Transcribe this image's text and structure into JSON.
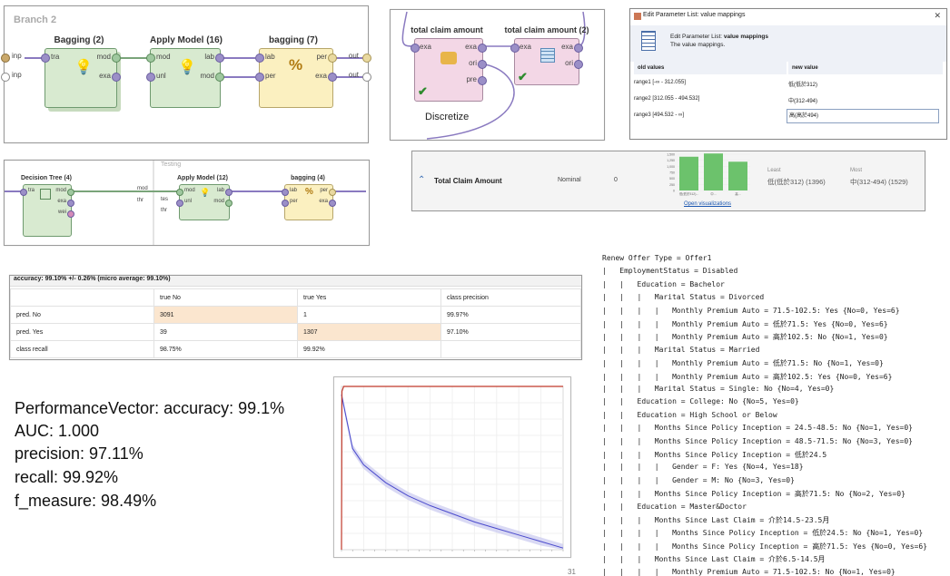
{
  "branch_panel": {
    "branch_title": "Branch 2",
    "bagging": {
      "title": "Bagging (2)",
      "in_port": "tra",
      "out_ports": [
        "mod",
        "exa"
      ]
    },
    "apply_model": {
      "title": "Apply Model (16)",
      "in_ports": [
        "mod",
        "unl"
      ],
      "out_ports": [
        "lab",
        "mod"
      ]
    },
    "perf": {
      "title": "bagging (7)",
      "in_ports": [
        "lab",
        "per"
      ],
      "out_ports": [
        "per",
        "exa"
      ]
    },
    "left_ports": [
      "inp",
      "inp"
    ],
    "right_ports": [
      "out",
      "out"
    ]
  },
  "discretize_panel": {
    "op1_title": "total claim amount",
    "op1_ports": [
      "exa",
      "exa",
      "ori",
      "pre"
    ],
    "op2_title": "total claim amount (2)",
    "op2_ports": [
      "exa",
      "exa",
      "ori"
    ],
    "caption": "Discretize"
  },
  "param_dialog": {
    "window_title": "Edit Parameter List: value mappings",
    "close_glyph": "✕",
    "header_prefix": "Edit Parameter List: ",
    "header_bold": "value mappings",
    "subheader": "The value mappings.",
    "columns": [
      "old values",
      "new value"
    ],
    "rows": [
      {
        "old": "range1 [-∞ - 312.055]",
        "new": "低(低於312)"
      },
      {
        "old": "range2 [312.055 - 494.532]",
        "new": "中(312-494)"
      },
      {
        "old": "range3 [494.532 - ∞]",
        "new": "高(高於494)"
      }
    ]
  },
  "tree_panel": {
    "tab": "Testing",
    "decision_tree": {
      "title": "Decision Tree (4)",
      "in_port": "tra",
      "out_ports": [
        "mod",
        "exa",
        "wei"
      ]
    },
    "apply_model": {
      "title": "Apply Model (12)",
      "in_ports": [
        "mod",
        "unl"
      ],
      "out_ports": [
        "lab",
        "mod"
      ],
      "left_labels": [
        "mod",
        "tes",
        "thr",
        "thr"
      ]
    },
    "perf": {
      "title": "bagging (4)",
      "in_ports": [
        "lab",
        "per"
      ],
      "out_ports": [
        "per",
        "exa"
      ]
    }
  },
  "stats_row": {
    "name": "Total Claim Amount",
    "type": "Nominal",
    "missing": "0",
    "least_label": "Least",
    "least_value": "低(低於312) (1396)",
    "most_label": "Most",
    "most_value": "中(312-494) (1529)",
    "link": "Open visualizations",
    "axis_ticks": [
      "1,500",
      "1,250",
      "1,000",
      "750",
      "500",
      "250",
      "0"
    ],
    "category_ticks": [
      "低(低於312)...",
      "中...",
      "高..."
    ],
    "chart_data": {
      "type": "bar",
      "categories": [
        "低(低於312)...",
        "中...",
        "高..."
      ],
      "values": [
        1396,
        1529,
        1190
      ],
      "ylim": [
        0,
        1500
      ]
    }
  },
  "confusion": {
    "title": "accuracy: 99.10% +/- 0.26% (micro average: 99.10%)",
    "header": [
      "",
      "true No",
      "true Yes",
      "class precision"
    ],
    "rows": [
      [
        "pred. No",
        "3091",
        "1",
        "99.97%"
      ],
      [
        "pred. Yes",
        "39",
        "1307",
        "97.10%"
      ],
      [
        "class recall",
        "98.75%",
        "99.92%",
        ""
      ]
    ]
  },
  "metrics": [
    "PerformanceVector: accuracy: 99.1%",
    "AUC: 1.000",
    "precision: 97.11%",
    "recall: 99.92%",
    "f_measure: 98.49%"
  ],
  "roc": {
    "chart_data": {
      "type": "line",
      "xlim": [
        0,
        1
      ],
      "ylim": [
        0,
        1
      ],
      "series": [
        {
          "values": [
            [
              0,
              0
            ],
            [
              0.002,
              0.97
            ],
            [
              0.01,
              1.0
            ],
            [
              1.0,
              1.0
            ]
          ]
        },
        {
          "values": [
            [
              0,
              0.95
            ],
            [
              0.05,
              0.62
            ],
            [
              0.1,
              0.52
            ],
            [
              0.2,
              0.41
            ],
            [
              0.3,
              0.33
            ],
            [
              0.4,
              0.27
            ],
            [
              0.5,
              0.22
            ],
            [
              0.6,
              0.17
            ],
            [
              0.7,
              0.13
            ],
            [
              0.8,
              0.09
            ],
            [
              0.9,
              0.05
            ],
            [
              1.0,
              0.01
            ]
          ]
        }
      ]
    },
    "colors": {
      "roc": "#c0392b",
      "threshold": "#4a4acc",
      "band": "#c9c9f0"
    }
  },
  "tree_text": [
    "Renew Offer Type = Offer1",
    "|   EmploymentStatus = Disabled",
    "|   |   Education = Bachelor",
    "|   |   |   Marital Status = Divorced",
    "|   |   |   |   Monthly Premium Auto = 71.5-102.5: Yes {No=0, Yes=6}",
    "|   |   |   |   Monthly Premium Auto = 低於71.5: Yes {No=0, Yes=6}",
    "|   |   |   |   Monthly Premium Auto = 高於102.5: No {No=1, Yes=0}",
    "|   |   |   Marital Status = Married",
    "|   |   |   |   Monthly Premium Auto = 低於71.5: No {No=1, Yes=0}",
    "|   |   |   |   Monthly Premium Auto = 高於102.5: Yes {No=0, Yes=6}",
    "|   |   |   Marital Status = Single: No {No=4, Yes=0}",
    "|   |   Education = College: No {No=5, Yes=0}",
    "|   |   Education = High School or Below",
    "|   |   |   Months Since Policy Inception = 24.5-48.5: No {No=1, Yes=0}",
    "|   |   |   Months Since Policy Inception = 48.5-71.5: No {No=3, Yes=0}",
    "|   |   |   Months Since Policy Inception = 低於24.5",
    "|   |   |   |   Gender = F: Yes {No=4, Yes=18}",
    "|   |   |   |   Gender = M: No {No=3, Yes=0}",
    "|   |   |   Months Since Policy Inception = 高於71.5: No {No=2, Yes=0}",
    "|   |   Education = Master&Doctor",
    "|   |   |   Months Since Last Claim = 介於14.5-23.5月",
    "|   |   |   |   Months Since Policy Inception = 低於24.5: No {No=1, Yes=0}",
    "|   |   |   |   Months Since Policy Inception = 高於71.5: Yes {No=0, Yes=6}",
    "|   |   |   Months Since Last Claim = 介於6.5-14.5月",
    "|   |   |   |   Monthly Premium Auto = 71.5-102.5: No {No=1, Yes=0}"
  ],
  "page_number": "31"
}
